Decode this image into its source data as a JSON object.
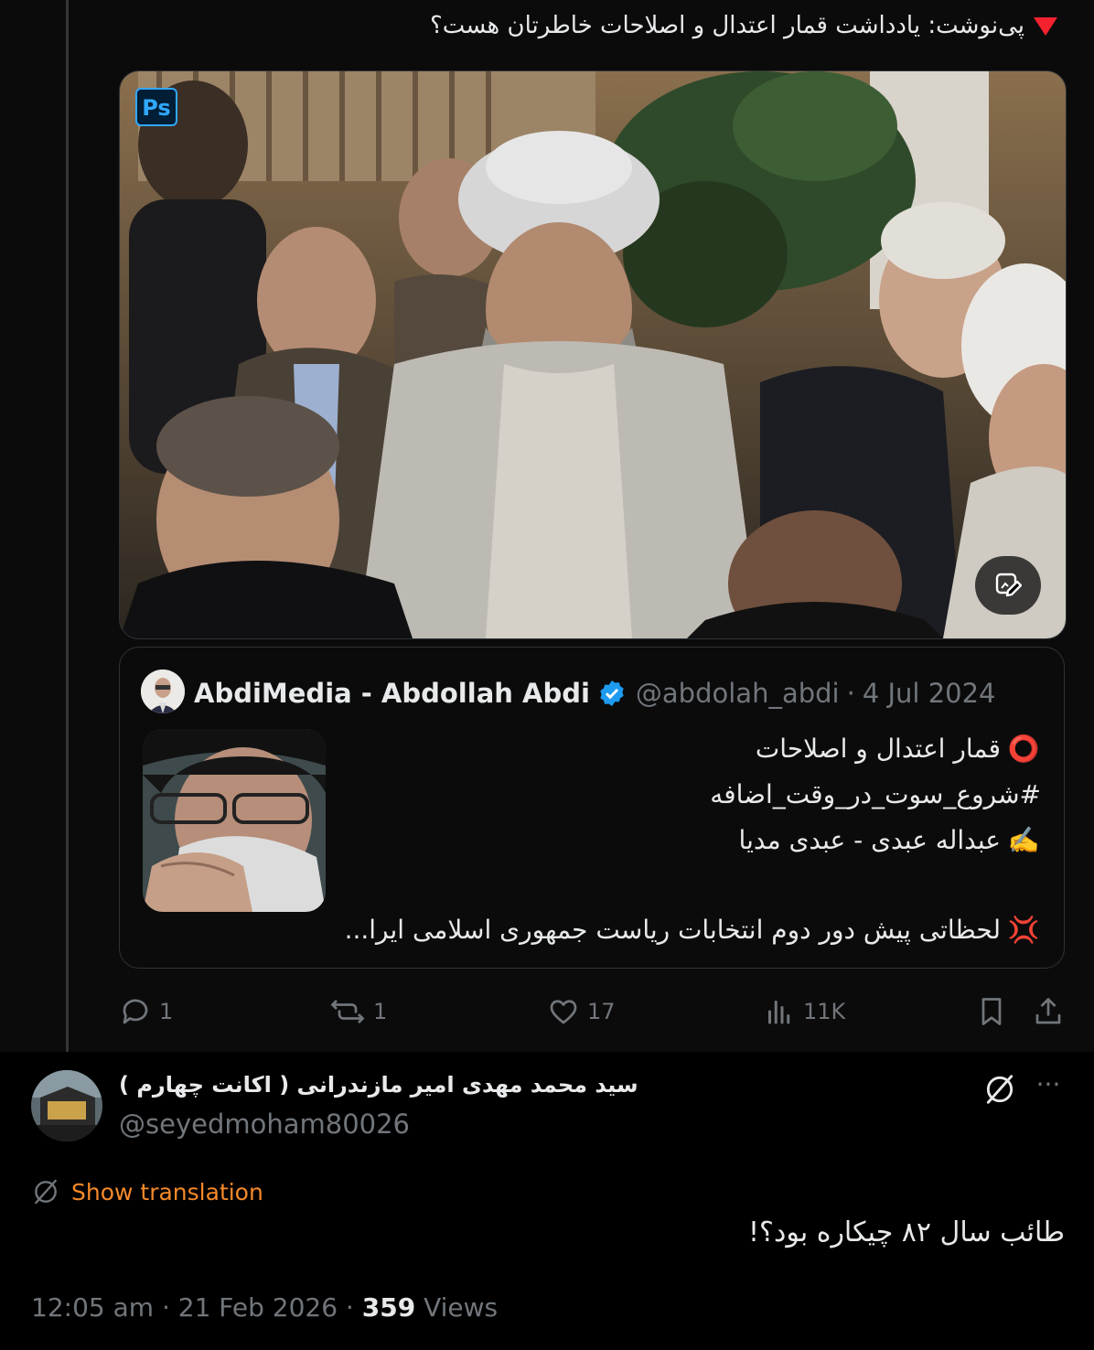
{
  "tweet": {
    "text": "پی‌نوشت: یادداشت قمار اعتدال و اصلاحات خاطرتان هست؟",
    "photo_badge": "Ps",
    "icons": {
      "marker": "red-triangle-icon",
      "edit": "edit-image-icon"
    }
  },
  "quote": {
    "author_name": "AbdiMedia - Abdollah Abdi",
    "handle": "@abdolah_abdi",
    "separator": "·",
    "date": "4 Jul 2024",
    "lines": [
      {
        "icon": "⭕",
        "text": "قمار اعتدال و اصلاحات"
      },
      {
        "icon": "",
        "text": "#شروع_سوت_در_وقت_اضافه"
      },
      {
        "icon": "✍️",
        "text": "عبداله عبدی - عبدی مدیا"
      },
      {
        "icon": "💢",
        "text": "لحظاتی پیش دور دوم انتخابات ریاست جمهوری اسلامی ایرا..."
      }
    ]
  },
  "actions": {
    "replies": "1",
    "reposts": "1",
    "likes": "17",
    "views": "11K"
  },
  "reply": {
    "author_name": "سید محمد مهدی امیر مازندرانی ( اکانت چهارم )",
    "handle": "@seyedmoham80026",
    "show_translation": "Show translation",
    "more": "···",
    "text": "طائب سال ۸۲ چیکاره بود؟!",
    "time": "12:05 am",
    "separator": "·",
    "date": "21 Feb 2026",
    "views_count": "359",
    "views_label": "Views"
  },
  "colors": {
    "accent_orange": "#f4892a",
    "verified_blue": "#1d9bf0",
    "muted": "#71767b",
    "marker_red": "#f4212e"
  }
}
